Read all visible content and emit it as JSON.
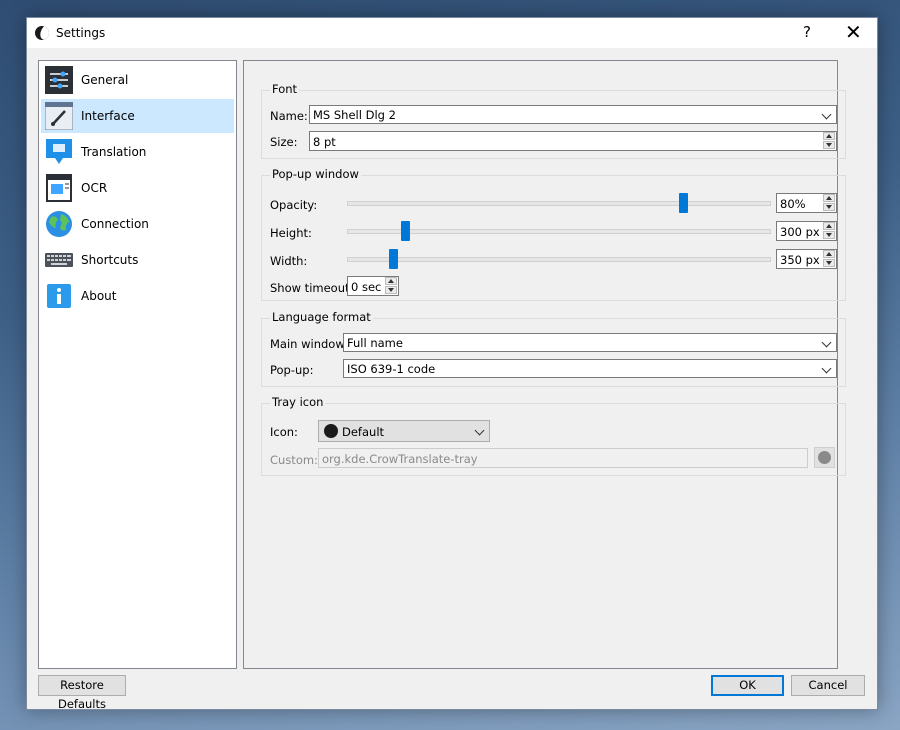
{
  "window": {
    "title": "Settings",
    "help_label": "?",
    "close_label": "✕"
  },
  "sidebar": {
    "items": [
      {
        "label": "General",
        "icon": "sliders-icon"
      },
      {
        "label": "Interface",
        "icon": "brush-icon"
      },
      {
        "label": "Translation",
        "icon": "speech-bubble-icon"
      },
      {
        "label": "OCR",
        "icon": "ocr-icon"
      },
      {
        "label": "Connection",
        "icon": "globe-icon"
      },
      {
        "label": "Shortcuts",
        "icon": "keyboard-icon"
      },
      {
        "label": "About",
        "icon": "info-icon"
      }
    ],
    "active": "Interface"
  },
  "font": {
    "title": "Font",
    "name_label": "Name:",
    "name_value": "MS Shell Dlg 2",
    "size_label": "Size:",
    "size_value": "8 pt"
  },
  "popup": {
    "title": "Pop-up window",
    "opacity_label": "Opacity:",
    "opacity_value": "80%",
    "opacity_level": 0.8,
    "height_label": "Height:",
    "height_value": "300 px",
    "height_level": 0.13,
    "width_label": "Width:",
    "width_value": "350 px",
    "width_level": 0.1,
    "timeout_label": "Show timeout:",
    "timeout_value": "0 sec"
  },
  "language": {
    "title": "Language format",
    "main_label": "Main window:",
    "main_value": "Full name",
    "popup_label": "Pop-up:",
    "popup_value": "ISO 639-1 code"
  },
  "tray": {
    "title": "Tray icon",
    "icon_label": "Icon:",
    "icon_value": "Default",
    "custom_label": "Custom:",
    "custom_value": "org.kde.CrowTranslate-tray"
  },
  "footer": {
    "restore_label": "Restore Defaults",
    "ok_label": "OK",
    "cancel_label": "Cancel"
  },
  "colors": {
    "accent": "#0078d7",
    "selection": "#cce8ff"
  }
}
